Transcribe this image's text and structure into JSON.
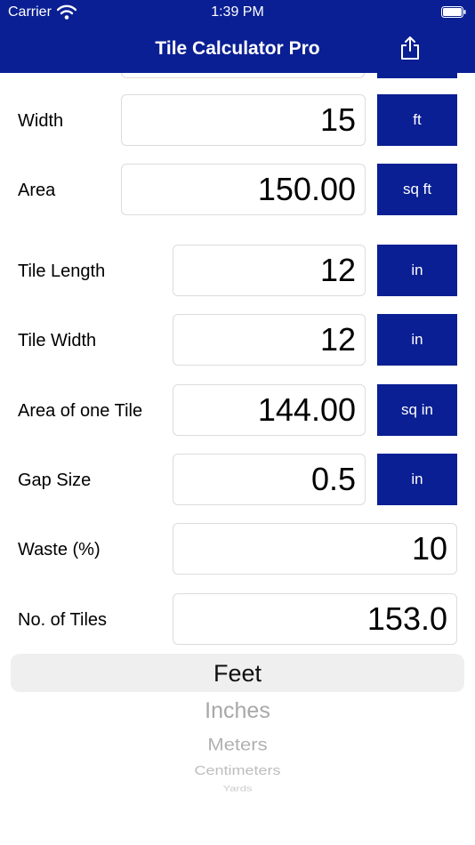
{
  "status": {
    "carrier": "Carrier",
    "time": "1:39 PM"
  },
  "nav": {
    "title": "Tile Calculator Pro",
    "share_icon": "share-icon"
  },
  "rows": {
    "width": {
      "label": "Width",
      "value": "15",
      "unit": "ft"
    },
    "area": {
      "label": "Area",
      "value": "150.00",
      "unit": "sq ft"
    },
    "tile_length": {
      "label": "Tile Length",
      "value": "12",
      "unit": "in"
    },
    "tile_width": {
      "label": "Tile Width",
      "value": "12",
      "unit": "in"
    },
    "tile_area": {
      "label": "Area of one Tile",
      "value": "144.00",
      "unit": "sq in"
    },
    "gap": {
      "label": "Gap Size",
      "value": "0.5",
      "unit": "in"
    },
    "waste": {
      "label": "Waste (%)",
      "value": "10"
    },
    "tiles": {
      "label": "No. of Tiles",
      "value": "153.0"
    }
  },
  "picker": {
    "options": [
      "Feet",
      "Inches",
      "Meters",
      "Centimeters",
      "Yards"
    ],
    "selected": "Feet"
  }
}
